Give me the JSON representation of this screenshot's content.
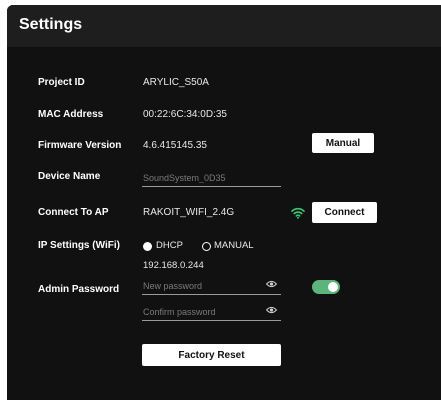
{
  "header": {
    "title": "Settings"
  },
  "fields": {
    "project_id": {
      "label": "Project ID",
      "value": "ARYLIC_S50A"
    },
    "mac_address": {
      "label": "MAC Address",
      "value": "00:22:6C:34:0D:35"
    },
    "firmware_version": {
      "label": "Firmware Version",
      "value": "4.6.415145.35",
      "button_label": "Manual"
    },
    "device_name": {
      "label": "Device Name",
      "placeholder": "SoundSystem_0D35"
    },
    "connect_to_ap": {
      "label": "Connect To AP",
      "value": "RAKOIT_WIFI_2.4G",
      "button_label": "Connect",
      "icon": "wifi-icon"
    },
    "ip_settings": {
      "label": "IP Settings (WiFi)",
      "options": [
        "DHCP",
        "MANUAL"
      ],
      "selected": "DHCP",
      "ip_address": "192.168.0.244"
    },
    "admin_password": {
      "label": "Admin Password",
      "new_placeholder": "New password",
      "confirm_placeholder": "Confirm password",
      "toggle_on": true
    }
  },
  "factory_reset": {
    "label": "Factory Reset"
  },
  "colors": {
    "background": "#111111",
    "header": "#1e1e1e",
    "accent_green": "#5bb57a",
    "wifi_green": "#2ecc71"
  }
}
